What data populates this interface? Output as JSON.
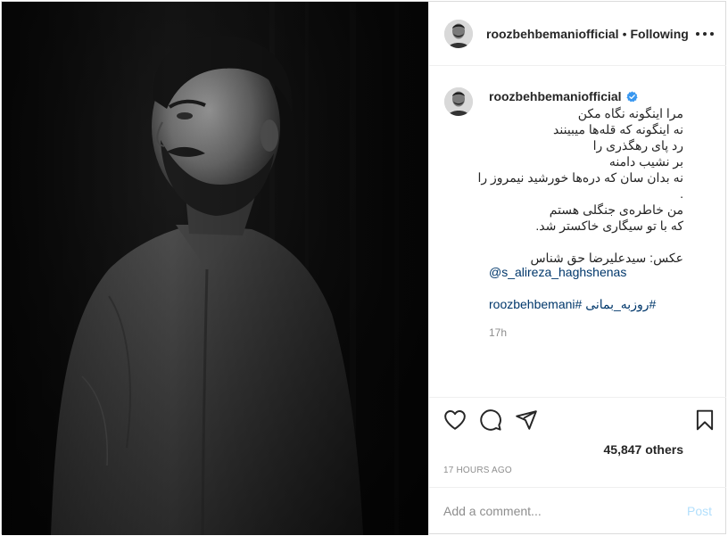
{
  "post": {
    "username": "roozbehbemaniofficial",
    "separator": "•",
    "follow_status": "Following",
    "more_icon": "more-options-icon"
  },
  "caption": {
    "username": "roozbehbemaniofficial",
    "verified_icon": "verified-badge-icon",
    "lines": [
      "مرا اینگونه نگاه مکن",
      "نه اینگونه که قله‌ها میبینند",
      "رد پای رهگذری را",
      "بر نشیب دامنه",
      "نه بدان سان که دره‌ها خورشید نیمروز را",
      ".",
      "من خاطره‌ی جنگلی هستم",
      "که با تو سیگاری خاکستر شد.",
      "",
      "عکس: سیدعلیرضا حق شناس"
    ],
    "mention": "@s_alireza_haghshenas",
    "hashtags": "#روزبه_بمانی #roozbehbemani",
    "time": "17h"
  },
  "actions": {
    "like_icon": "heart-icon",
    "comment_icon": "comment-icon",
    "share_icon": "share-icon",
    "save_icon": "bookmark-icon",
    "likes_text": "45,847 others",
    "time_ago": "17 HOURS AGO"
  },
  "comment": {
    "placeholder": "Add a comment...",
    "post_label": "Post"
  },
  "colors": {
    "link": "#00376b",
    "post_disabled": "#b2dffc",
    "verified": "#3897f0",
    "muted": "#8e8e8e"
  }
}
